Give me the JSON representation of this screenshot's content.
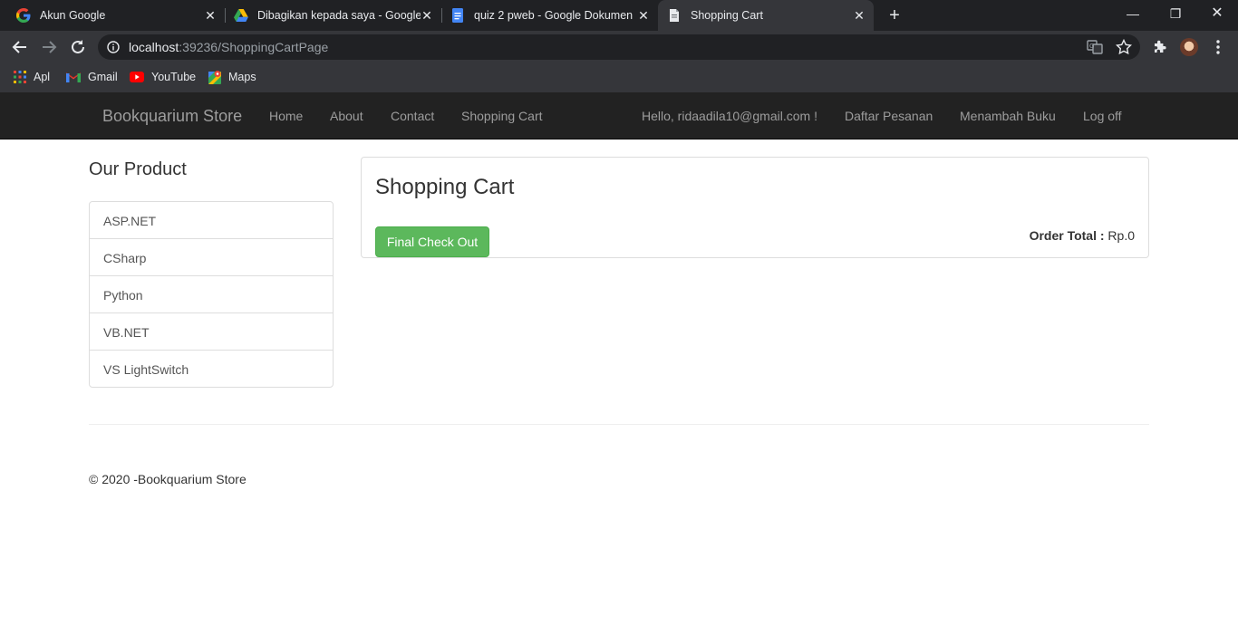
{
  "browser": {
    "tabs": [
      {
        "title": "Akun Google",
        "icon": "google-icon",
        "active": false
      },
      {
        "title": "Dibagikan kepada saya - Google",
        "icon": "google-drive-icon",
        "active": false
      },
      {
        "title": "quiz 2 pweb - Google Dokumen",
        "icon": "google-docs-icon",
        "active": false
      },
      {
        "title": "Shopping Cart",
        "icon": "page-icon",
        "active": true
      }
    ],
    "url_host": "localhost",
    "url_path": ":39236/ShoppingCartPage",
    "bookmarks": [
      {
        "label": "Apl",
        "icon": "apps-grid-icon"
      },
      {
        "label": "Gmail",
        "icon": "gmail-icon"
      },
      {
        "label": "YouTube",
        "icon": "youtube-icon"
      },
      {
        "label": "Maps",
        "icon": "maps-icon"
      }
    ]
  },
  "site": {
    "brand": "Bookquarium Store",
    "nav_left": [
      "Home",
      "About",
      "Contact",
      "Shopping Cart"
    ],
    "nav_right": [
      "Hello, ridaadila10@gmail.com !",
      "Daftar Pesanan",
      "Menambah Buku",
      "Log off"
    ]
  },
  "sidebar": {
    "title": "Our Product",
    "items": [
      "ASP.NET",
      "CSharp",
      "Python",
      "VB.NET",
      "VS LightSwitch"
    ]
  },
  "cart": {
    "title": "Shopping Cart",
    "checkout_label": "Final Check Out",
    "order_total_label": "Order Total :",
    "order_total_value": "Rp.0"
  },
  "footer": {
    "text": "© 2020 -Bookquarium Store"
  },
  "colors": {
    "navbar_bg": "#222222",
    "nav_text": "#9d9d9d",
    "checkout_green": "#5cb85c",
    "chrome_dark": "#202124",
    "chrome_toolbar": "#35363a"
  }
}
